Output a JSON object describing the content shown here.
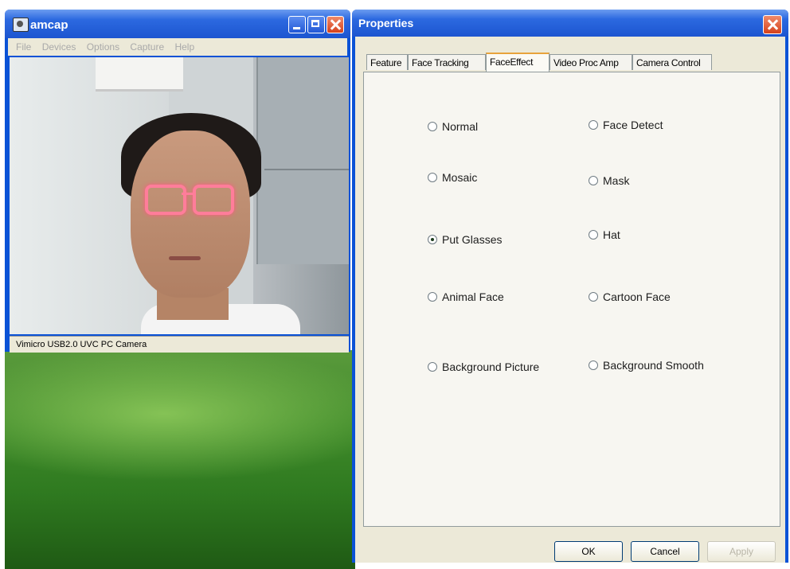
{
  "amcap": {
    "title": "amcap",
    "menu": [
      "File",
      "Devices",
      "Options",
      "Capture",
      "Help"
    ],
    "status": "Vimicro USB2.0 UVC PC Camera"
  },
  "properties": {
    "title": "Properties",
    "tabs": [
      "Feature",
      "Face Tracking",
      "FaceEffect",
      "Video Proc Amp",
      "Camera Control"
    ],
    "active_tab": "FaceEffect",
    "options": [
      {
        "label": "Normal",
        "checked": false
      },
      {
        "label": "Face Detect",
        "checked": false
      },
      {
        "label": "Mosaic",
        "checked": false
      },
      {
        "label": "Mask",
        "checked": false
      },
      {
        "label": "Put Glasses",
        "checked": true
      },
      {
        "label": "Hat",
        "checked": false
      },
      {
        "label": "Animal Face",
        "checked": false
      },
      {
        "label": "Cartoon Face",
        "checked": false
      },
      {
        "label": "Background Picture",
        "checked": false
      },
      {
        "label": "Background Smooth",
        "checked": false
      }
    ],
    "buttons": {
      "ok": "OK",
      "cancel": "Cancel",
      "apply": "Apply"
    }
  },
  "colors": {
    "titlebar": "#2c69e0",
    "dialog_bg": "#ece9d8",
    "active_tab_accent": "#e8a33b"
  }
}
